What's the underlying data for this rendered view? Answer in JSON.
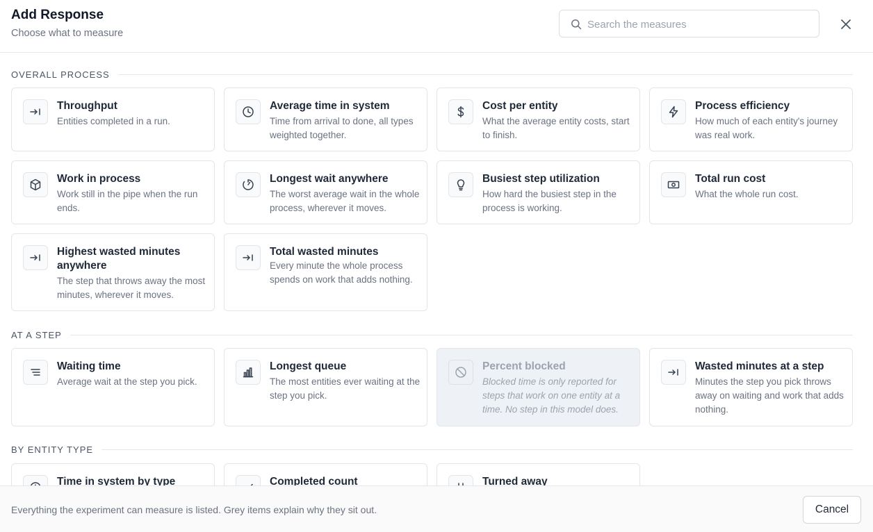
{
  "header": {
    "title": "Add Response",
    "subtitle": "Choose what to measure",
    "search_placeholder": "Search the measures"
  },
  "sections": {
    "overall": {
      "title": "OVERALL PROCESS",
      "cards": [
        {
          "title": "Throughput",
          "desc": "Entities completed in a run.",
          "icon": "arrow-right-icon"
        },
        {
          "title": "Average time in system",
          "desc": "Time from arrival to done, all types weighted together.",
          "icon": "clock-icon"
        },
        {
          "title": "Cost per entity",
          "desc": "What the average entity costs, start to finish.",
          "icon": "dollar-icon"
        },
        {
          "title": "Process efficiency",
          "desc": "How much of each entity's journey was real work.",
          "icon": "lightning-icon"
        },
        {
          "title": "Work in process",
          "desc": "Work still in the pipe when the run ends.",
          "icon": "cube-icon"
        },
        {
          "title": "Longest wait anywhere",
          "desc": "The worst average wait in the whole process, wherever it moves.",
          "icon": "timer-icon"
        },
        {
          "title": "Busiest step utilization",
          "desc": "How hard the busiest step in the process is working.",
          "icon": "lightbulb-icon"
        },
        {
          "title": "Total run cost",
          "desc": "What the whole run cost.",
          "icon": "banknote-icon"
        },
        {
          "title": "Highest wasted minutes anywhere",
          "desc": "The step that throws away the most minutes, wherever it moves.",
          "icon": "arrow-right-icon"
        },
        {
          "title": "Total wasted minutes",
          "desc": "Every minute the whole process spends on work that adds nothing.",
          "icon": "arrow-right-icon"
        }
      ]
    },
    "step": {
      "title": "AT A STEP",
      "cards": [
        {
          "title": "Waiting time",
          "desc": "Average wait at the step you pick.",
          "icon": "lines-icon"
        },
        {
          "title": "Longest queue",
          "desc": "The most entities ever waiting at the step you pick.",
          "icon": "bar-chart-icon"
        },
        {
          "title": "Percent blocked",
          "desc": "Blocked time is only reported for steps that work on one entity at a time. No step in this model does.",
          "icon": "ban-icon",
          "disabled": true
        },
        {
          "title": "Wasted minutes at a step",
          "desc": "Minutes the step you pick throws away on waiting and work that adds nothing.",
          "icon": "arrow-right-icon"
        }
      ]
    },
    "entity": {
      "title": "BY ENTITY TYPE",
      "cards": [
        {
          "title": "Time in system by type",
          "icon": "clock-icon"
        },
        {
          "title": "Completed count",
          "icon": "check-icon"
        },
        {
          "title": "Turned away",
          "icon": "turned-away-icon"
        }
      ]
    }
  },
  "footer": {
    "note": "Everything the experiment can measure is listed. Grey items explain why they sit out.",
    "cancel_label": "Cancel"
  }
}
